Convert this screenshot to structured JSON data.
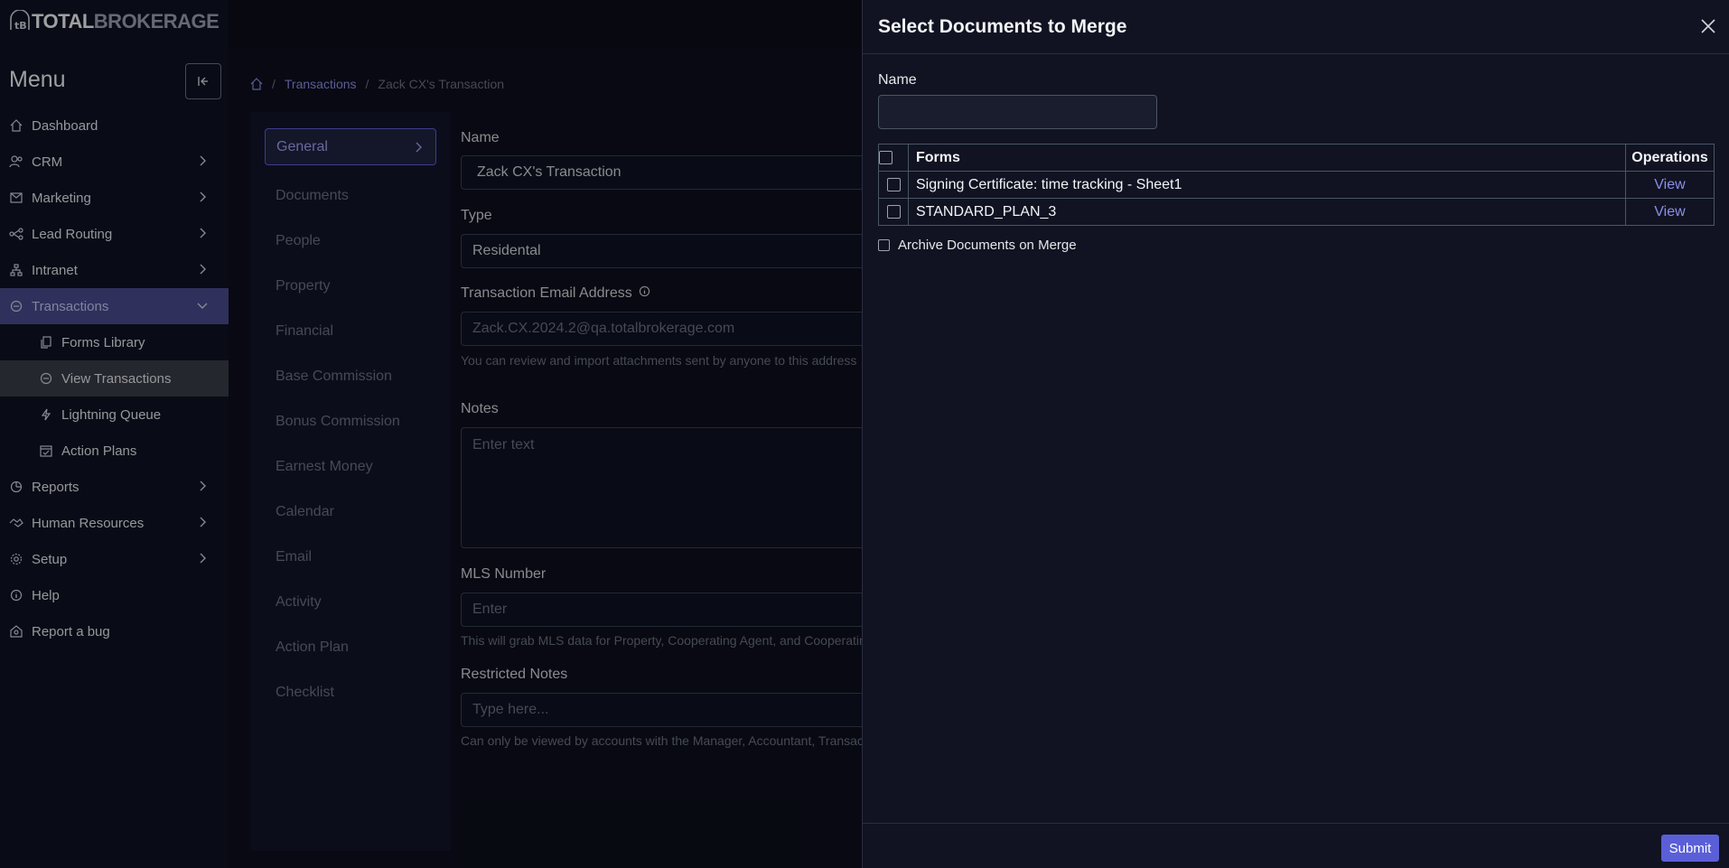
{
  "logo": {
    "text_total": "TOTAL",
    "text_brokerage": "BROKERAGE"
  },
  "sidebar": {
    "title": "Menu",
    "items": [
      {
        "label": "Dashboard",
        "icon": "home-icon",
        "chevron": false
      },
      {
        "label": "CRM",
        "icon": "users-icon",
        "chevron": true
      },
      {
        "label": "Marketing",
        "icon": "mail-icon",
        "chevron": true
      },
      {
        "label": "Lead Routing",
        "icon": "routing-icon",
        "chevron": true
      },
      {
        "label": "Intranet",
        "icon": "network-icon",
        "chevron": true
      },
      {
        "label": "Transactions",
        "icon": "transactions-icon",
        "chevron": true,
        "active": true
      },
      {
        "label": "Forms Library",
        "icon": "copy-icon",
        "sub": true
      },
      {
        "label": "View Transactions",
        "icon": "transactions-icon",
        "sub": true,
        "selected": true
      },
      {
        "label": "Lightning Queue",
        "icon": "lightning-icon",
        "sub": true
      },
      {
        "label": "Action Plans",
        "icon": "calendar-check-icon",
        "sub": true
      },
      {
        "label": "Reports",
        "icon": "chart-icon",
        "chevron": true
      },
      {
        "label": "Human Resources",
        "icon": "handshake-icon",
        "chevron": true
      },
      {
        "label": "Setup",
        "icon": "gear-icon",
        "chevron": true
      },
      {
        "label": "Help",
        "icon": "info-icon",
        "chevron": false
      },
      {
        "label": "Report a bug",
        "icon": "bug-icon",
        "chevron": false
      }
    ]
  },
  "breadcrumb": {
    "transactions": "Transactions",
    "current": "Zack CX's Transaction",
    "sep": "/"
  },
  "tabs": [
    "General",
    "Documents",
    "People",
    "Property",
    "Financial",
    "Base Commission",
    "Bonus Commission",
    "Earnest Money",
    "Calendar",
    "Email",
    "Activity",
    "Action Plan",
    "Checklist"
  ],
  "form": {
    "name_label": "Name",
    "name_value": "Zack CX's Transaction",
    "type_label": "Type",
    "type_value": "Residental",
    "email_label": "Transaction Email Address",
    "email_value": "Zack.CX.2024.2@qa.totalbrokerage.com",
    "email_help": "You can review and import attachments sent by anyone to this address",
    "notes_label": "Notes",
    "notes_placeholder": "Enter text",
    "mls_label": "MLS Number",
    "mls_placeholder": "Enter",
    "mls_help": "This will grab MLS data for Property, Cooperating Agent, and Cooperating",
    "restricted_label": "Restricted Notes",
    "restricted_placeholder": "Type here...",
    "restricted_help": "Can only be viewed by accounts with the Manager, Accountant, Transaction"
  },
  "drawer": {
    "title": "Select Documents to Merge",
    "name_label": "Name",
    "name_value": "",
    "table": {
      "headers": {
        "forms": "Forms",
        "operations": "Operations"
      },
      "rows": [
        {
          "form": "Signing Certificate: time tracking - Sheet1",
          "op": "View"
        },
        {
          "form": "STANDARD_PLAN_3",
          "op": "View"
        }
      ]
    },
    "archive_label": "Archive Documents on Merge",
    "submit_label": "Submit"
  }
}
